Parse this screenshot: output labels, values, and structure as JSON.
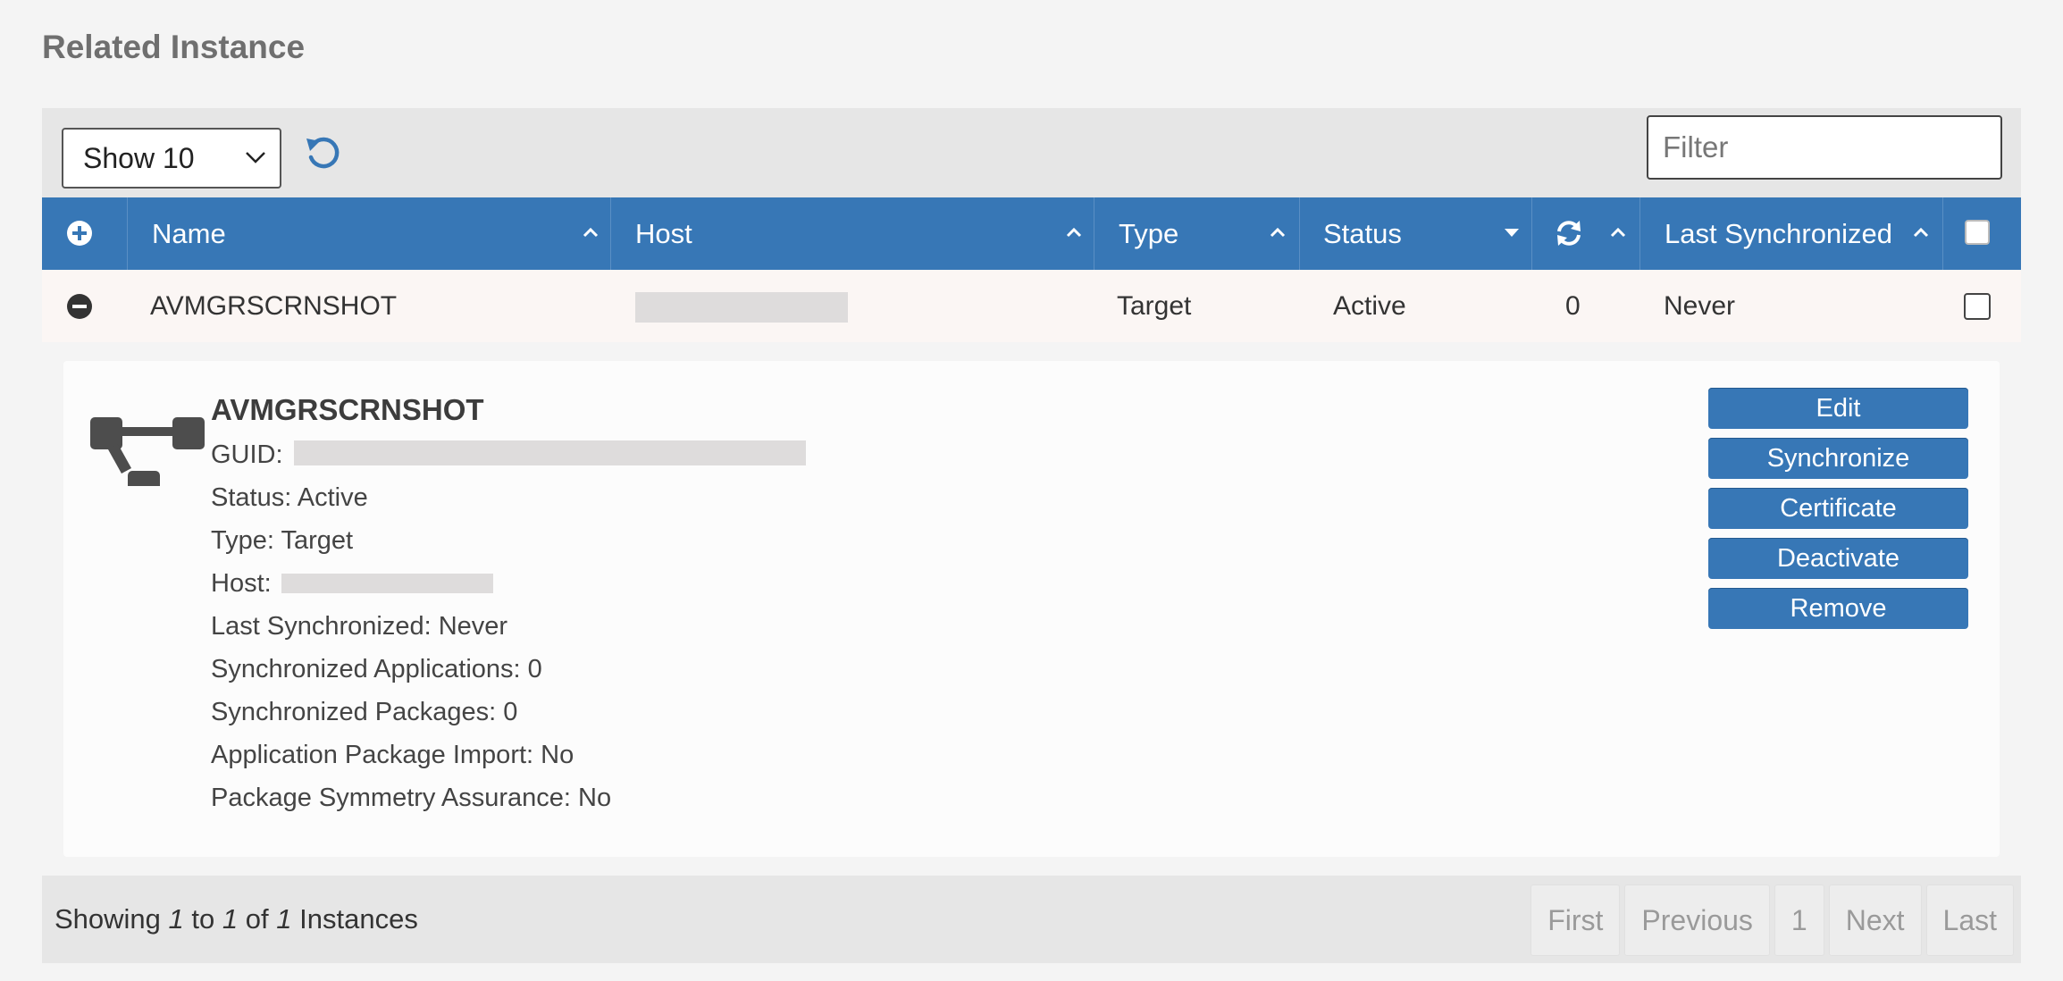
{
  "page": {
    "title": "Related Instance"
  },
  "toolbar": {
    "show_select": "Show 10",
    "filter_placeholder": "Filter"
  },
  "columns": {
    "name": "Name",
    "host": "Host",
    "type": "Type",
    "status": "Status",
    "last_synchronized": "Last Synchronized"
  },
  "row": {
    "name": "AVMGRSCRNSHOT",
    "type": "Target",
    "status": "Active",
    "sync_count": "0",
    "last_synchronized": "Never"
  },
  "detail": {
    "title": "AVMGRSCRNSHOT",
    "guid_label": "GUID:",
    "status": "Status: Active",
    "type": "Type: Target",
    "host_label": "Host:",
    "last_synchronized": "Last Synchronized: Never",
    "synchronized_applications": "Synchronized Applications: 0",
    "synchronized_packages": "Synchronized Packages: 0",
    "application_package_import": "Application Package Import: No",
    "package_symmetry_assurance": "Package Symmetry Assurance: No"
  },
  "actions": {
    "edit": "Edit",
    "synchronize": "Synchronize",
    "certificate": "Certificate",
    "deactivate": "Deactivate",
    "remove": "Remove"
  },
  "footer": {
    "showing": "Showing",
    "from": "1",
    "to_word": "to",
    "to": "1",
    "of_word": "of",
    "total": "1",
    "unit": "Instances"
  },
  "pager": {
    "first": "First",
    "previous": "Previous",
    "page": "1",
    "next": "Next",
    "last": "Last"
  },
  "icons": {
    "refresh": "refresh-icon",
    "expand_all": "plus-circle-icon",
    "collapse_row": "minus-circle-icon",
    "sync_column": "sync-icon",
    "instance": "hierarchy-icon"
  },
  "colors": {
    "accent": "#3777b6",
    "header_text": "#ffffff",
    "page_bg": "#f4f4f4"
  }
}
